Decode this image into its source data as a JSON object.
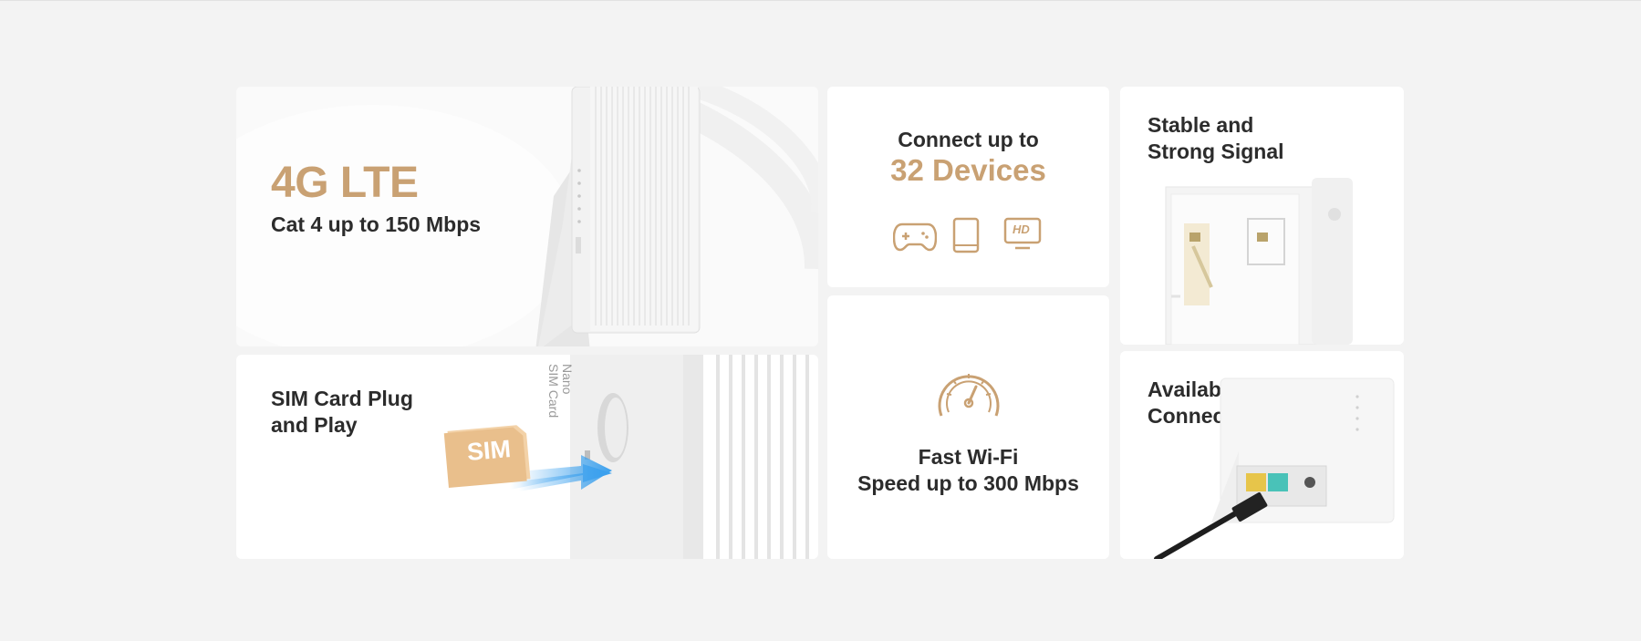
{
  "cards": {
    "lte": {
      "title": "4G LTE",
      "subtitle": "Cat 4 up to 150 Mbps"
    },
    "sim": {
      "title_line1": "SIM Card Plug",
      "title_line2": "and Play",
      "sim_label": "SIM",
      "slot_label_line1": "Nano",
      "slot_label_line2": "SIM Card"
    },
    "devices": {
      "line1": "Connect up to",
      "line2": "32 Devices",
      "icons": [
        "gamepad-icon",
        "tablet-icon",
        "hd-tv-icon"
      ],
      "hd_label": "HD"
    },
    "wifi": {
      "line1": "Fast Wi-Fi",
      "line2": "Speed up to 300 Mbps",
      "icon": "speedometer-icon"
    },
    "signal": {
      "line1": "Stable and",
      "line2": "Strong Signal"
    },
    "wan": {
      "line1": "Available WAN",
      "line2": "Connection"
    }
  },
  "colors": {
    "background": "#f3f3f3",
    "card": "#ffffff",
    "accent_gold": "#c9a173",
    "text_dark": "#2c2c2c",
    "arrow_blue": "#3aa0ee"
  }
}
